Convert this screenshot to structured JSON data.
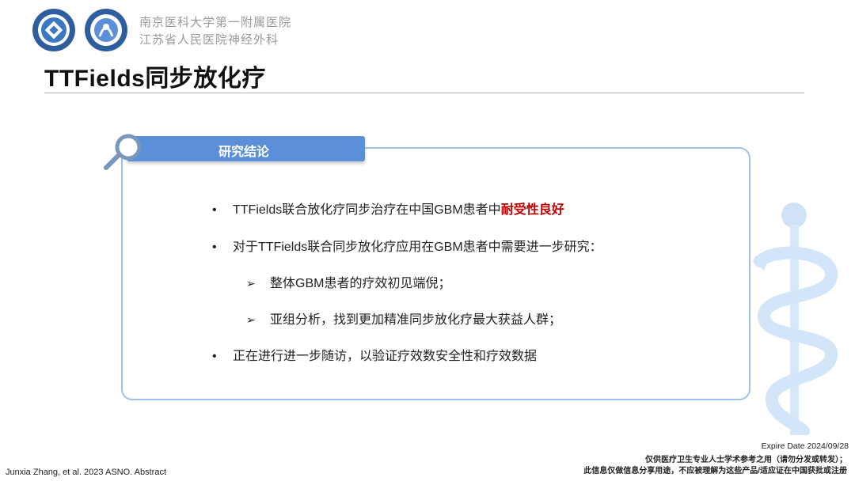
{
  "header": {
    "hospital_line1": "南京医科大学第一附属医院",
    "hospital_line2": "江苏省人民医院神经外科",
    "title": "TTFields同步放化疗"
  },
  "panel": {
    "tab_label": "研究结论",
    "points": [
      {
        "bullet": "•",
        "text": "TTFields联合放化疗同步治疗在中国GBM患者中",
        "highlight": "耐受性良好"
      },
      {
        "bullet": "•",
        "text": "对于TTFields联合同步放化疗应用在GBM患者中需要进一步研究："
      },
      {
        "bullet": "•",
        "text": "正在进行进一步随访，以验证疗效数安全性和疗效数据"
      }
    ],
    "subpoints": [
      {
        "arrow": "➢",
        "text": "整体GBM患者的疗效初见端倪；"
      },
      {
        "arrow": "➢",
        "text": "亚组分析，找到更加精准同步放化疗最大获益人群；"
      }
    ]
  },
  "footer": {
    "citation": "Junxia Zhang, et al. 2023 ASNO. Abstract",
    "expire": "Expire Date 2024/09/28",
    "disclaimer1": "仅供医疗卫生专业人士学术参考之用（请勿分发或转发）；",
    "disclaimer2": "此信息仅做信息分享用途，不应被理解为这些产品/适应证在中国获批或注册"
  },
  "colors": {
    "accent": "#5b8fd8",
    "panel_border": "#9ec1ea",
    "highlight": "#c00000"
  }
}
